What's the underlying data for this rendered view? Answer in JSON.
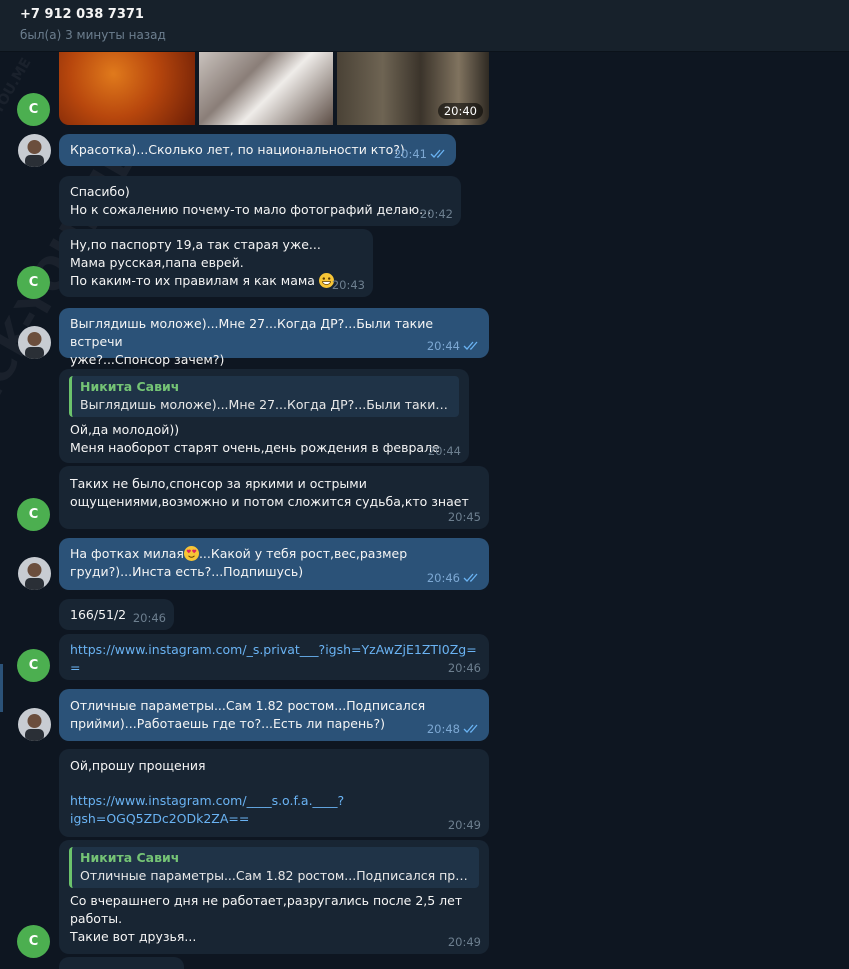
{
  "header": {
    "contact": "+7 912 038 7371",
    "status": "был(а) 3 минуты назад"
  },
  "watermark": "CHECK-YOU.ME",
  "photos": {
    "time": "20:40"
  },
  "messages": [
    {
      "dir": "out",
      "text": "Красотка)...Сколько лет, по национальности кто?)",
      "time": "20:41"
    },
    {
      "dir": "in",
      "text": "Спасибо)\nНо к сожалению почему-то мало фотографий делаю...",
      "time": "20:42"
    },
    {
      "dir": "in",
      "text": "Ну,по паспорту 19,а так старая уже...\nМама русская,папа еврей.\nПо каким-то их правилам я как мама",
      "time": "20:43"
    },
    {
      "dir": "out",
      "text": "Выглядишь моложе)...Мне 27...Когда ДР?...Были такие встречи\nуже?...Спонсор зачем?)",
      "time": "20:44"
    },
    {
      "dir": "in",
      "reply_name": "Никита Савич",
      "reply_text": "Выглядишь моложе)...Мне 27...Когда ДР?...Были такие вст...",
      "text": "Ой,да молодой))\nМеня наоборот старят очень,день рождения в феврале",
      "time": "20:44"
    },
    {
      "dir": "in",
      "text": "Таких не было,спонсор за яркими и острыми\nощущениями,возможно и потом сложится судьба,кто знает",
      "time": "20:45"
    },
    {
      "dir": "out",
      "text_before": "На фотках милая",
      "text_after": "...Какой у тебя рост,вес,размер\nгруди?)...Инста есть?...Подпишусь)",
      "time": "20:46"
    },
    {
      "dir": "in",
      "text": "166/51/2",
      "time": "20:46"
    },
    {
      "dir": "in",
      "link": "https://www.instagram.com/_s.privat___?igsh=YzAwZjE1ZTI0Zg==",
      "time": "20:46"
    },
    {
      "dir": "out",
      "text": "Отличные параметры...Сам 1.82 ростом...Подписался\nприйми)...Работаешь где то?...Есть ли парень?)",
      "time": "20:48"
    },
    {
      "dir": "in",
      "text": "Ой,прошу прощения",
      "link": "https://www.instagram.com/____s.o.f.a.____?\nigsh=OGQ5ZDc2ODk2ZA==",
      "time": "20:49"
    },
    {
      "dir": "in",
      "reply_name": "Никита Савич",
      "reply_text": "Отличные параметры...Сам 1.82 ростом...Подписался прийм...",
      "text": "Со вчерашнего дня не работает,разругались после 2,5 лет\nработы.\nТакие вот друзья...",
      "time": "20:49"
    }
  ],
  "avatar_letter": "C",
  "colors": {
    "background": "#0e1621",
    "incoming": "#182533",
    "outgoing": "#2b5278",
    "link": "#6ab3f3",
    "avatar": "#4caf50",
    "reply_name": "#75c475"
  }
}
